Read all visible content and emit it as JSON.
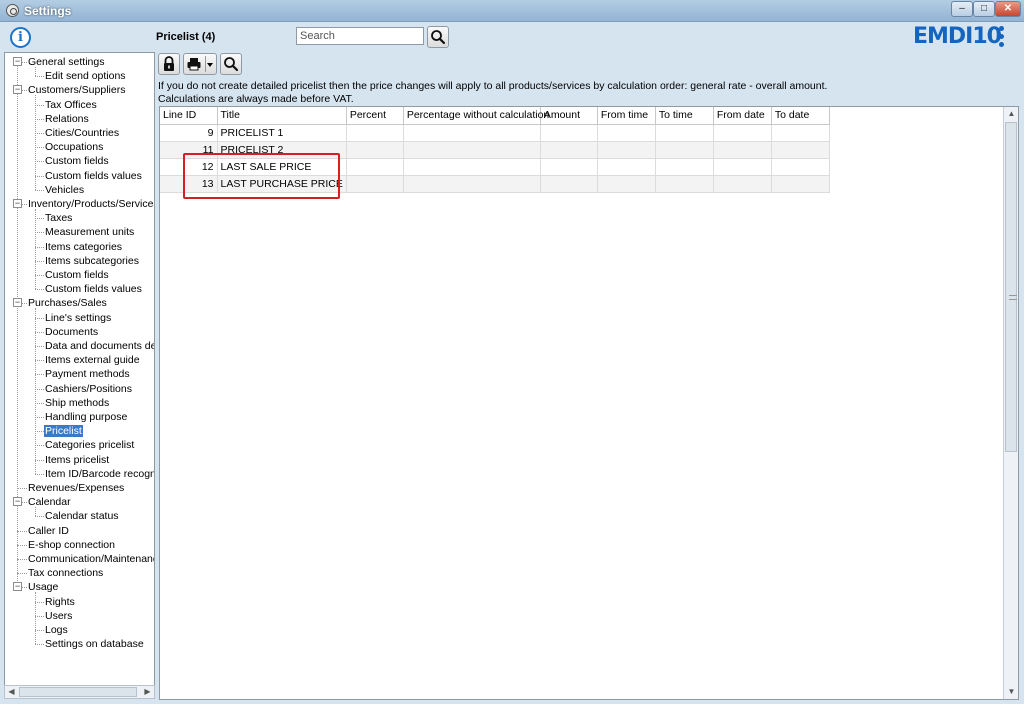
{
  "window": {
    "title": "Settings",
    "minimize": "‒",
    "maximize": "□",
    "close": "✕"
  },
  "header": {
    "info_icon": "i",
    "page_title": "Pricelist (4)",
    "search_placeholder": "Search",
    "brand": "EMDI10"
  },
  "notice": [
    "If you do not create detailed pricelist then the price changes will apply to all products/services by calculation order: general rate - overall amount.",
    "Calculations are always made before VAT."
  ],
  "tree": [
    {
      "label": "General settings",
      "level": 0,
      "expander": "−"
    },
    {
      "label": "Edit send options",
      "level": 1
    },
    {
      "label": "Customers/Suppliers",
      "level": 0,
      "expander": "−"
    },
    {
      "label": "Tax Offices",
      "level": 1
    },
    {
      "label": "Relations",
      "level": 1
    },
    {
      "label": "Cities/Countries",
      "level": 1
    },
    {
      "label": "Occupations",
      "level": 1
    },
    {
      "label": "Custom fields",
      "level": 1
    },
    {
      "label": "Custom fields values",
      "level": 1
    },
    {
      "label": "Vehicles",
      "level": 1
    },
    {
      "label": "Inventory/Products/Services",
      "level": 0,
      "expander": "−"
    },
    {
      "label": "Taxes",
      "level": 1
    },
    {
      "label": "Measurement units",
      "level": 1
    },
    {
      "label": "Items categories",
      "level": 1
    },
    {
      "label": "Items subcategories",
      "level": 1
    },
    {
      "label": "Custom fields",
      "level": 1
    },
    {
      "label": "Custom fields values",
      "level": 1
    },
    {
      "label": "Purchases/Sales",
      "level": 0,
      "expander": "−"
    },
    {
      "label": "Line's settings",
      "level": 1
    },
    {
      "label": "Documents",
      "level": 1
    },
    {
      "label": "Data and documents desi",
      "level": 1
    },
    {
      "label": "Items external guide",
      "level": 1
    },
    {
      "label": "Payment methods",
      "level": 1
    },
    {
      "label": "Cashiers/Positions",
      "level": 1
    },
    {
      "label": "Ship methods",
      "level": 1
    },
    {
      "label": "Handling purpose",
      "level": 1
    },
    {
      "label": "Pricelist",
      "level": 1,
      "selected": true
    },
    {
      "label": "Categories pricelist",
      "level": 1
    },
    {
      "label": "Items pricelist",
      "level": 1
    },
    {
      "label": "Item ID/Barcode recognize",
      "level": 1
    },
    {
      "label": "Revenues/Expenses",
      "level": 0
    },
    {
      "label": "Calendar",
      "level": 0,
      "expander": "−"
    },
    {
      "label": "Calendar status",
      "level": 1
    },
    {
      "label": "Caller ID",
      "level": 0
    },
    {
      "label": "E-shop connection",
      "level": 0
    },
    {
      "label": "Communication/Maintenance",
      "level": 0
    },
    {
      "label": "Tax connections",
      "level": 0
    },
    {
      "label": "Usage",
      "level": 0,
      "expander": "−"
    },
    {
      "label": "Rights",
      "level": 1
    },
    {
      "label": "Users",
      "level": 1
    },
    {
      "label": "Logs",
      "level": 1
    },
    {
      "label": "Settings on database",
      "level": 1
    }
  ],
  "grid": {
    "columns": [
      "Line ID",
      "Title",
      "Percent",
      "Percentage without calculation",
      "Amount",
      "From time",
      "To time",
      "From date",
      "To date"
    ],
    "rows": [
      [
        "9",
        "PRICELIST 1",
        "",
        "",
        "",
        "",
        "",
        "",
        ""
      ],
      [
        "11",
        "PRICELIST 2",
        "",
        "",
        "",
        "",
        "",
        "",
        ""
      ],
      [
        "12",
        "LAST SALE PRICE",
        "",
        "",
        "",
        "",
        "",
        "",
        ""
      ],
      [
        "13",
        "LAST PURCHASE PRICE",
        "",
        "",
        "",
        "",
        "",
        "",
        ""
      ]
    ]
  },
  "colors": {
    "accent": "#1565c0",
    "highlight": "#d42020",
    "selection": "#3a78c9"
  },
  "icons": {
    "lock": "lock-icon",
    "print": "printer-icon",
    "preview": "magnifier-icon",
    "search": "magnifier-icon"
  }
}
